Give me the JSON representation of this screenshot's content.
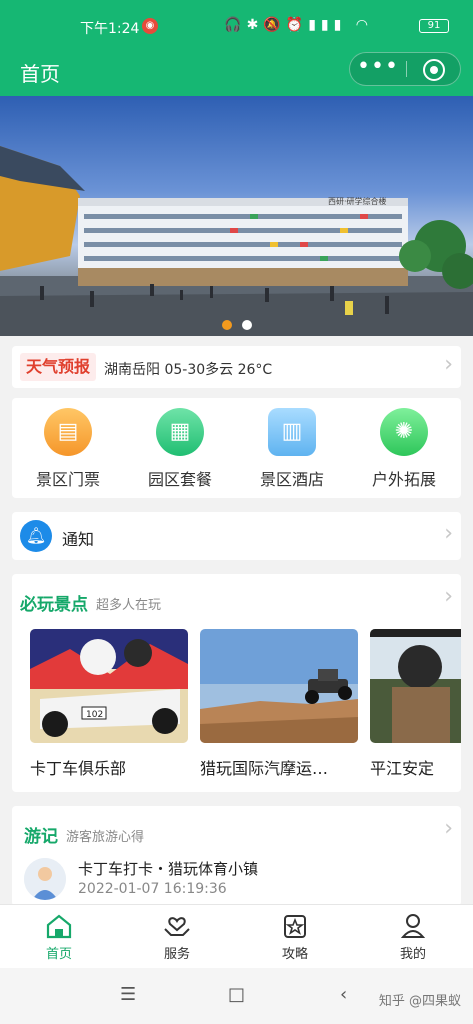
{
  "status_bar": {
    "time": "下午1:24",
    "battery": "91"
  },
  "nav": {
    "title": "首页",
    "more": "•••"
  },
  "banner": {
    "building_sign": "西研·研学综合楼",
    "slides": 2,
    "active_slide": 0
  },
  "weather": {
    "tag": "天气预报",
    "info": "湖南岳阳 05-30多云 26°C"
  },
  "quick": [
    {
      "label": "景区门票",
      "icon": "ticket-icon"
    },
    {
      "label": "园区套餐",
      "icon": "package-icon"
    },
    {
      "label": "景区酒店",
      "icon": "hotel-icon"
    },
    {
      "label": "户外拓展",
      "icon": "outdoor-icon"
    }
  ],
  "notice": {
    "label": "通知"
  },
  "spots": {
    "title": "必玩景点",
    "subtitle": "超多人在玩",
    "items": [
      {
        "name": "卡丁车俱乐部",
        "badge": "102"
      },
      {
        "name": "猎玩国际汽摩运…"
      },
      {
        "name": "平江安定"
      }
    ]
  },
  "travel": {
    "title": "游记",
    "subtitle": "游客旅游心得",
    "post": {
      "title": "卡丁车打卡・猎玩体育小镇",
      "time": "2022-01-07 16:19:36"
    }
  },
  "tabs": [
    {
      "label": "首页",
      "active": true
    },
    {
      "label": "服务"
    },
    {
      "label": "攻略"
    },
    {
      "label": "我的"
    }
  ],
  "system_nav": {
    "watermark": "知乎 @四果蚁"
  },
  "colors": {
    "brand": "#16b773",
    "accent": "#16a86a",
    "tag_red": "#e0402e"
  }
}
